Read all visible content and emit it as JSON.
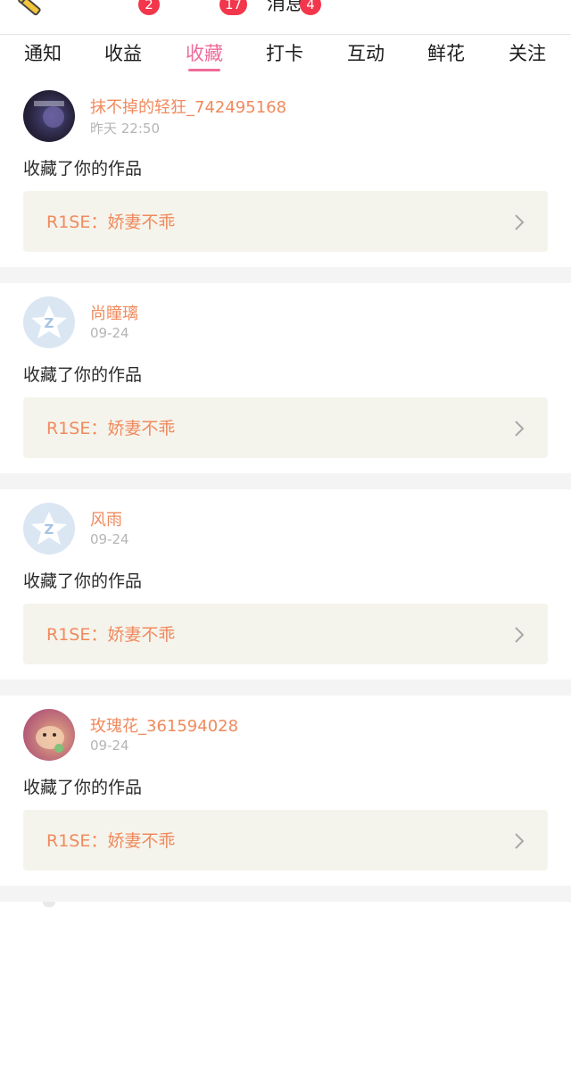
{
  "header": {
    "title": "消息"
  },
  "tabs": [
    {
      "label": "通知",
      "badge": "",
      "active": false
    },
    {
      "label": "收益",
      "badge": "2",
      "active": false
    },
    {
      "label": "收藏",
      "badge": "17",
      "active": true
    },
    {
      "label": "打卡",
      "badge": "4",
      "active": false
    },
    {
      "label": "互动",
      "badge": "",
      "active": false
    },
    {
      "label": "鲜花",
      "badge": "",
      "active": false
    },
    {
      "label": "关注",
      "badge": "",
      "active": false
    }
  ],
  "feed": [
    {
      "username": "抹不掉的轻狂_742495168",
      "time": "昨天 22:50",
      "action": "收藏了你的作品",
      "work_title": "R1SE：娇妻不乖",
      "avatar": "dark-photo-avatar"
    },
    {
      "username": "尚瞳璃",
      "time": "09-24",
      "action": "收藏了你的作品",
      "work_title": "R1SE：娇妻不乖",
      "avatar": "default-qq-avatar"
    },
    {
      "username": "风雨",
      "time": "09-24",
      "action": "收藏了你的作品",
      "work_title": "R1SE：娇妻不乖",
      "avatar": "default-qq-avatar"
    },
    {
      "username": "玫瑰花_361594028",
      "time": "09-24",
      "action": "收藏了你的作品",
      "work_title": "R1SE：娇妻不乖",
      "avatar": "dog-photo-avatar"
    }
  ],
  "colors": {
    "accent_pink": "#ef6b9a",
    "badge_red": "#f2364b",
    "username_orange": "#f08a5d",
    "work_box_bg": "#f5f4ec"
  },
  "icons": [
    "edit-icon",
    "chevron-right-icon",
    "default-qq-avatar"
  ]
}
